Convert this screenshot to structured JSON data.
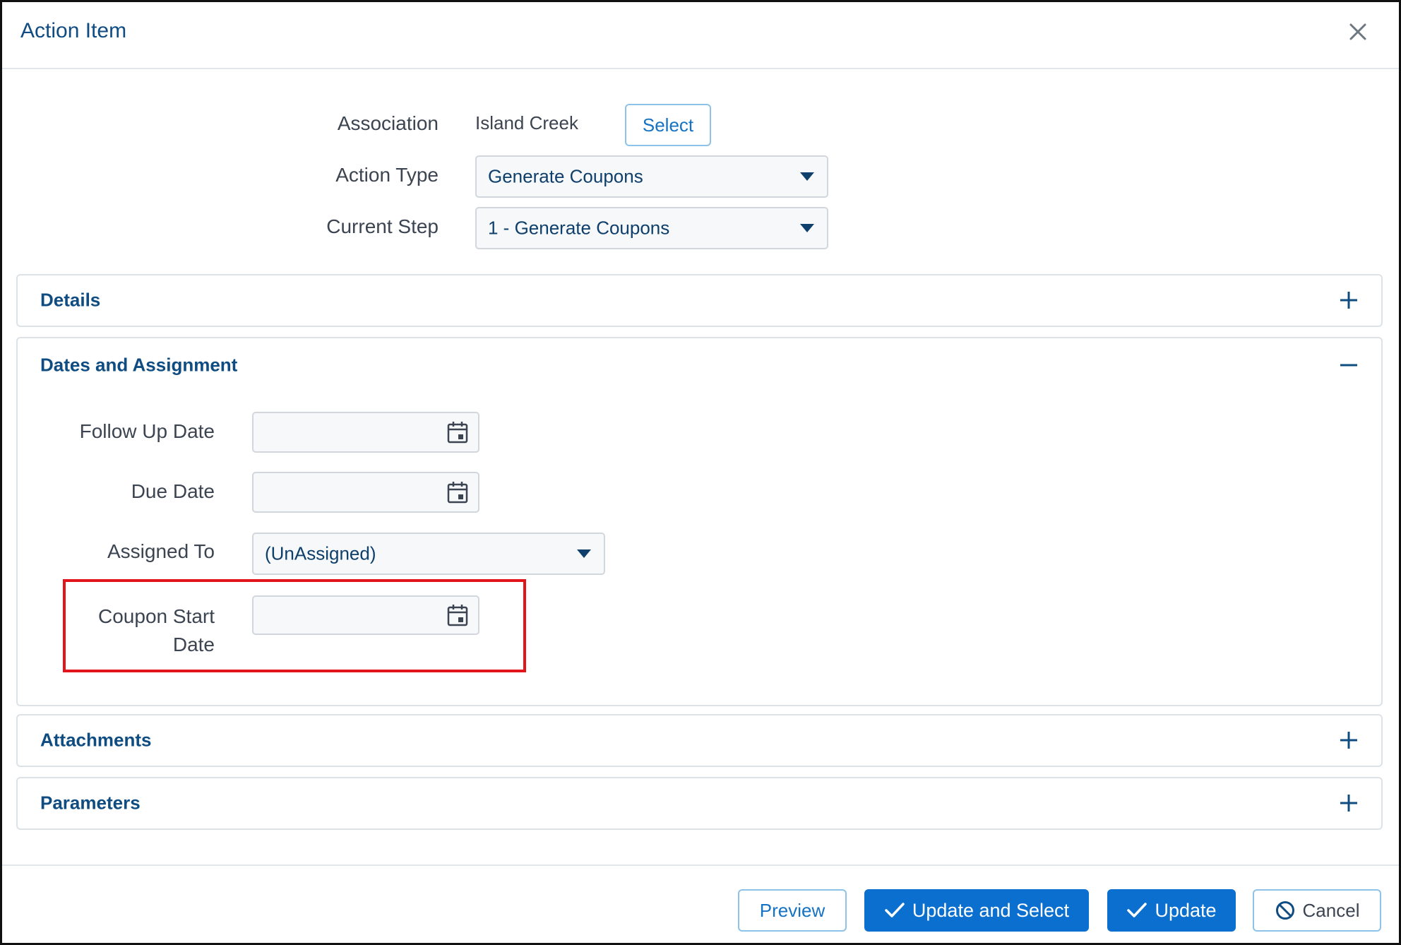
{
  "dialog": {
    "title": "Action Item"
  },
  "form": {
    "association_label": "Association",
    "association_value": "Island Creek",
    "select_button": "Select",
    "action_type_label": "Action Type",
    "action_type_value": "Generate Coupons",
    "current_step_label": "Current Step",
    "current_step_value": "1 - Generate Coupons"
  },
  "panels": {
    "details": {
      "title": "Details",
      "state": "collapsed"
    },
    "dates": {
      "title": "Dates and Assignment",
      "state": "expanded",
      "follow_up_label": "Follow Up Date",
      "follow_up_value": "",
      "due_date_label": "Due Date",
      "due_date_value": "",
      "assigned_to_label": "Assigned To",
      "assigned_to_value": "(UnAssigned)",
      "coupon_start_label_line1": "Coupon Start",
      "coupon_start_label_line2": "Date",
      "coupon_start_value": ""
    },
    "attachments": {
      "title": "Attachments",
      "state": "collapsed"
    },
    "parameters": {
      "title": "Parameters",
      "state": "collapsed"
    }
  },
  "footer": {
    "preview": "Preview",
    "update_and_select": "Update and Select",
    "update": "Update",
    "cancel": "Cancel"
  },
  "icons": [
    "close-icon",
    "caret-down-icon",
    "calendar-icon",
    "plus-icon",
    "minus-icon",
    "check-icon",
    "ban-icon"
  ],
  "colors": {
    "accent": "#0a6fcf",
    "heading": "#0f4c81",
    "highlight": "#e3151c"
  }
}
